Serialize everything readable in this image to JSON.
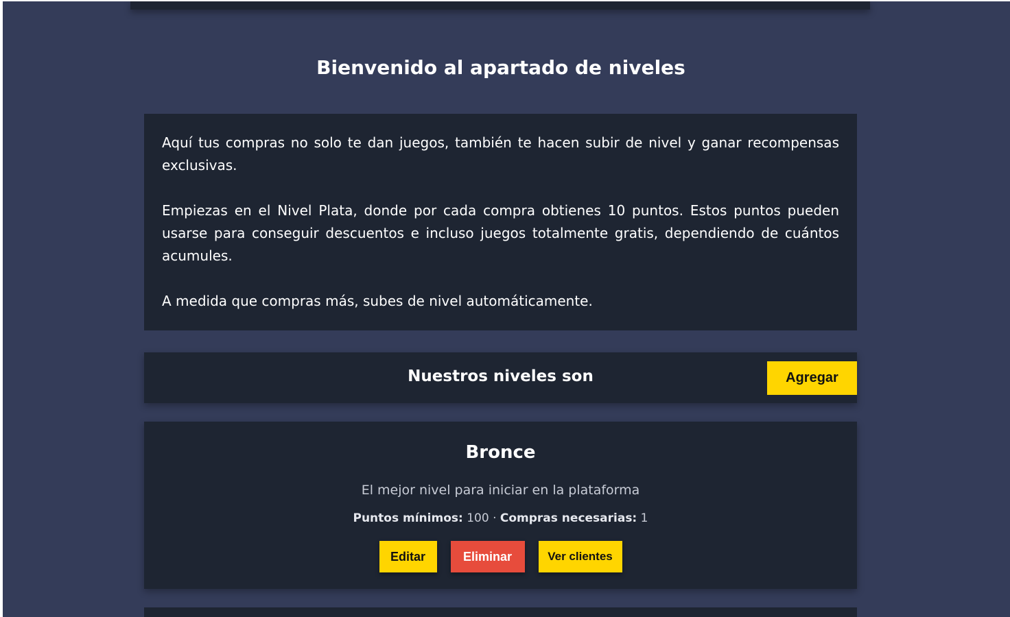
{
  "page": {
    "title": "Bienvenido al apartado de niveles"
  },
  "intro": {
    "paragraphs": [
      "Aquí tus compras no solo te dan juegos, también te hacen subir de nivel y ganar recompensas exclusivas.",
      "Empiezas en el Nivel Plata, donde por cada compra obtienes 10 puntos. Estos puntos pueden usarse para conseguir descuentos e incluso juegos totalmente gratis, dependiendo de cuántos acumules.",
      "A medida que compras más, subes de nivel automáticamente."
    ]
  },
  "levels_section": {
    "title": "Nuestros niveles son",
    "add_label": "Agregar"
  },
  "levels": [
    {
      "name": "Bronce",
      "description": "El mejor nivel para iniciar en la plataforma",
      "min_points_label": "Puntos mínimos:",
      "min_points": "100",
      "separator": "·",
      "purchases_label": "Compras necesarias:",
      "purchases": "1",
      "edit_label": "Editar",
      "delete_label": "Eliminar",
      "clients_label": "Ver clientes"
    }
  ],
  "colors": {
    "background": "#343c59",
    "card": "#1e2532",
    "accent_yellow": "#ffd500",
    "danger_red": "#e74c3c"
  }
}
